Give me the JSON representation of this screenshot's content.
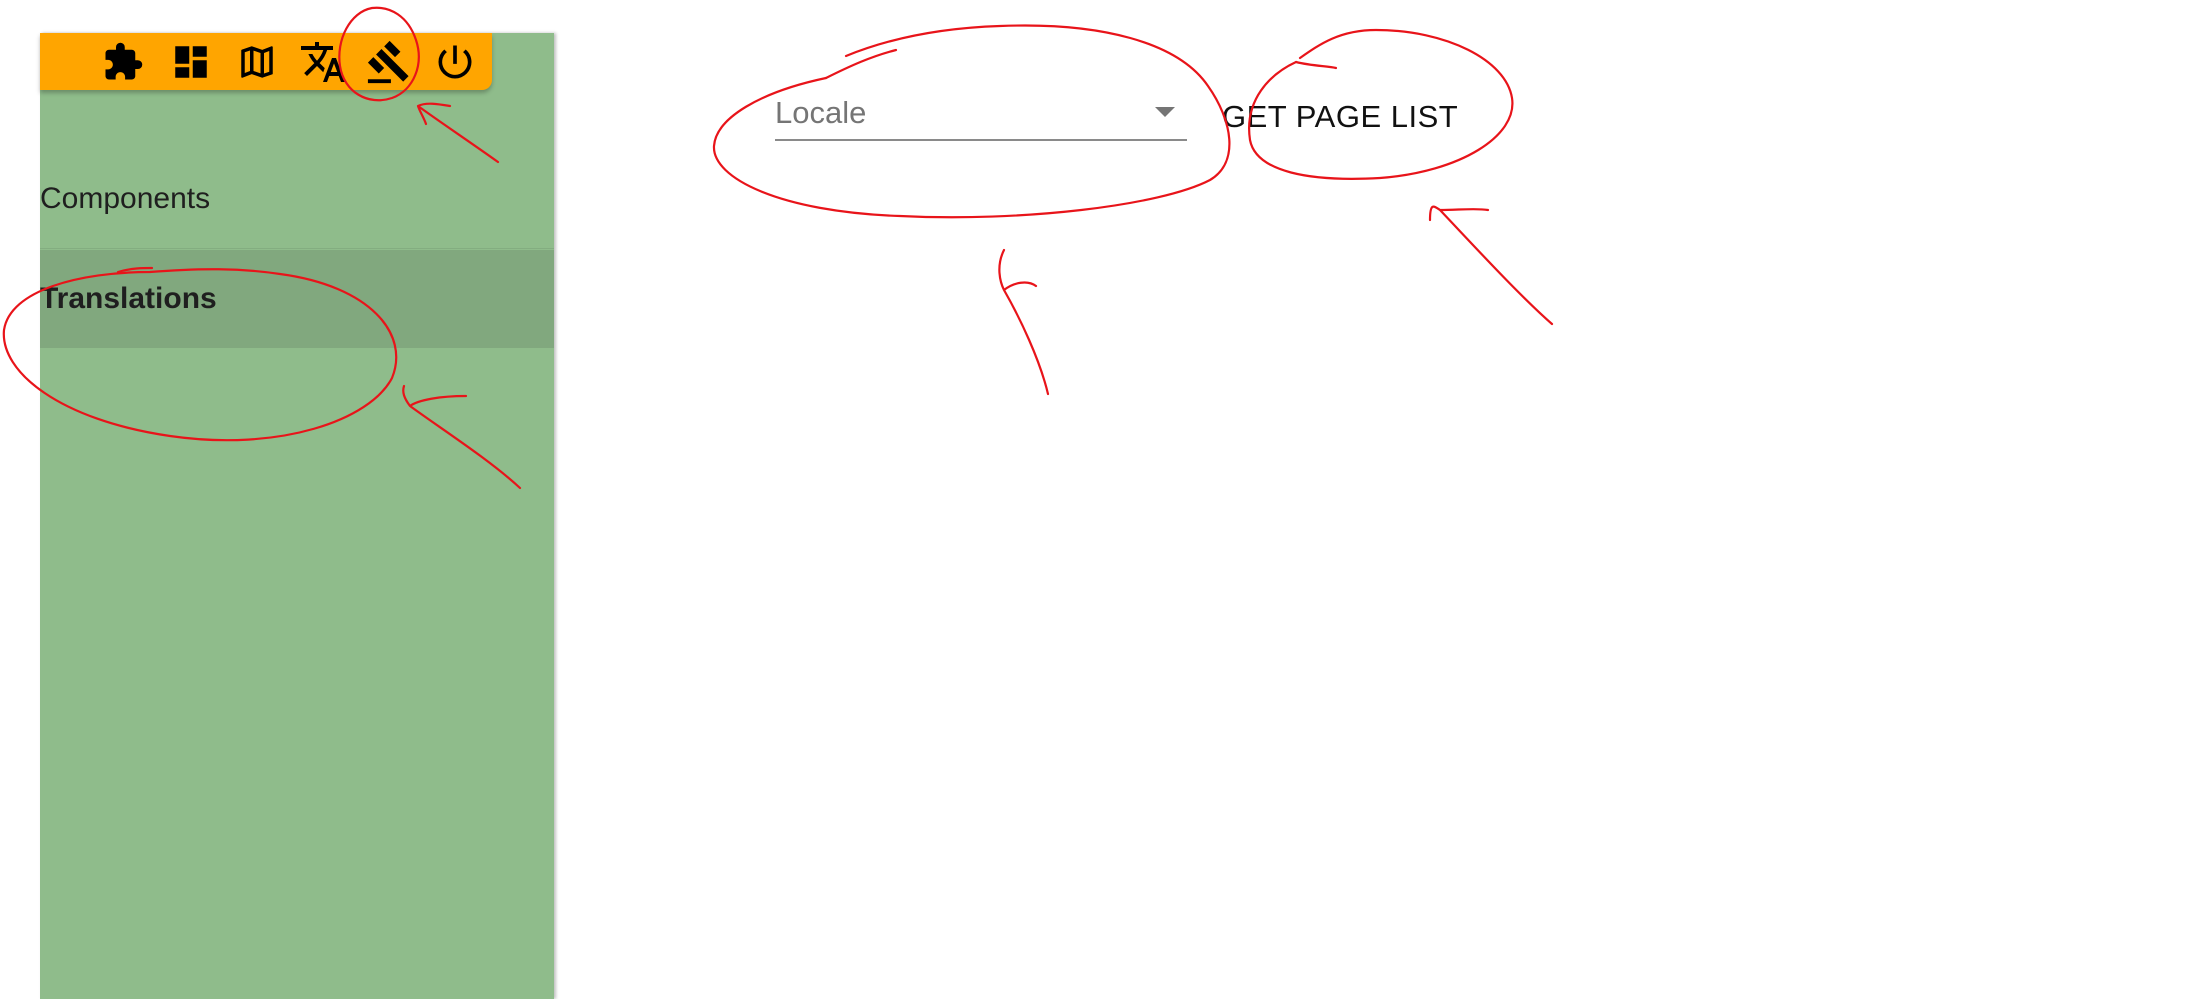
{
  "toolbar": {
    "tools": [
      {
        "icon": "puzzle-icon"
      },
      {
        "icon": "dashboard-icon"
      },
      {
        "icon": "map-icon"
      },
      {
        "icon": "translate-icon"
      },
      {
        "icon": "gavel-icon"
      },
      {
        "icon": "power-icon"
      }
    ]
  },
  "sidebar": {
    "items": [
      {
        "label": "Components",
        "active": false
      },
      {
        "label": "Translations",
        "active": true
      }
    ]
  },
  "main": {
    "locale_select": {
      "label": "Locale",
      "value": ""
    },
    "page_list_button": {
      "label": "GET PAGE LIST"
    }
  },
  "colors": {
    "toolbar_bg": "#ffa500",
    "sidebar_bg": "#8fbc8b",
    "sidebar_active_bg": "#81a87e",
    "annotation": "#e8141a"
  }
}
